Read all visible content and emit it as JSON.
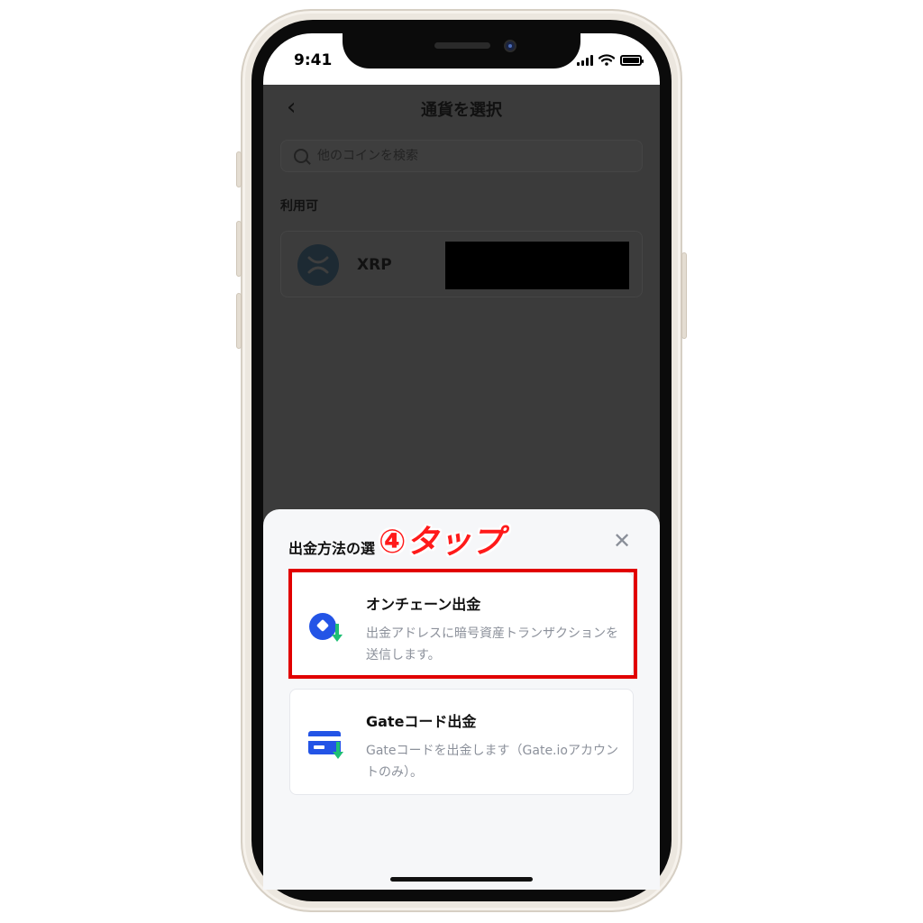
{
  "status_bar": {
    "time": "9:41"
  },
  "header": {
    "back_icon": "chevron-left-icon",
    "title": "通貨を選択"
  },
  "search": {
    "placeholder": "他のコインを検索"
  },
  "available": {
    "label": "利用可",
    "coins": [
      {
        "name": "XRP",
        "icon": "xrp-icon"
      }
    ]
  },
  "sheet": {
    "title": "出金方法の選",
    "close_icon": "close-icon",
    "annotation": "④タップ",
    "options": [
      {
        "title": "オンチェーン出金",
        "description": "出金アドレスに暗号資産トランザクションを送信します。",
        "icon": "onchain-withdraw-icon"
      },
      {
        "title": "Gateコード出金",
        "description": "Gateコードを出金します（Gate.ioアカウントのみ）。",
        "icon": "gate-code-card-icon"
      }
    ]
  },
  "colors": {
    "accent_blue": "#2354e6",
    "accent_green": "#1fbf75",
    "highlight_red": "#e10000",
    "overlay": "#3b3b3b"
  }
}
